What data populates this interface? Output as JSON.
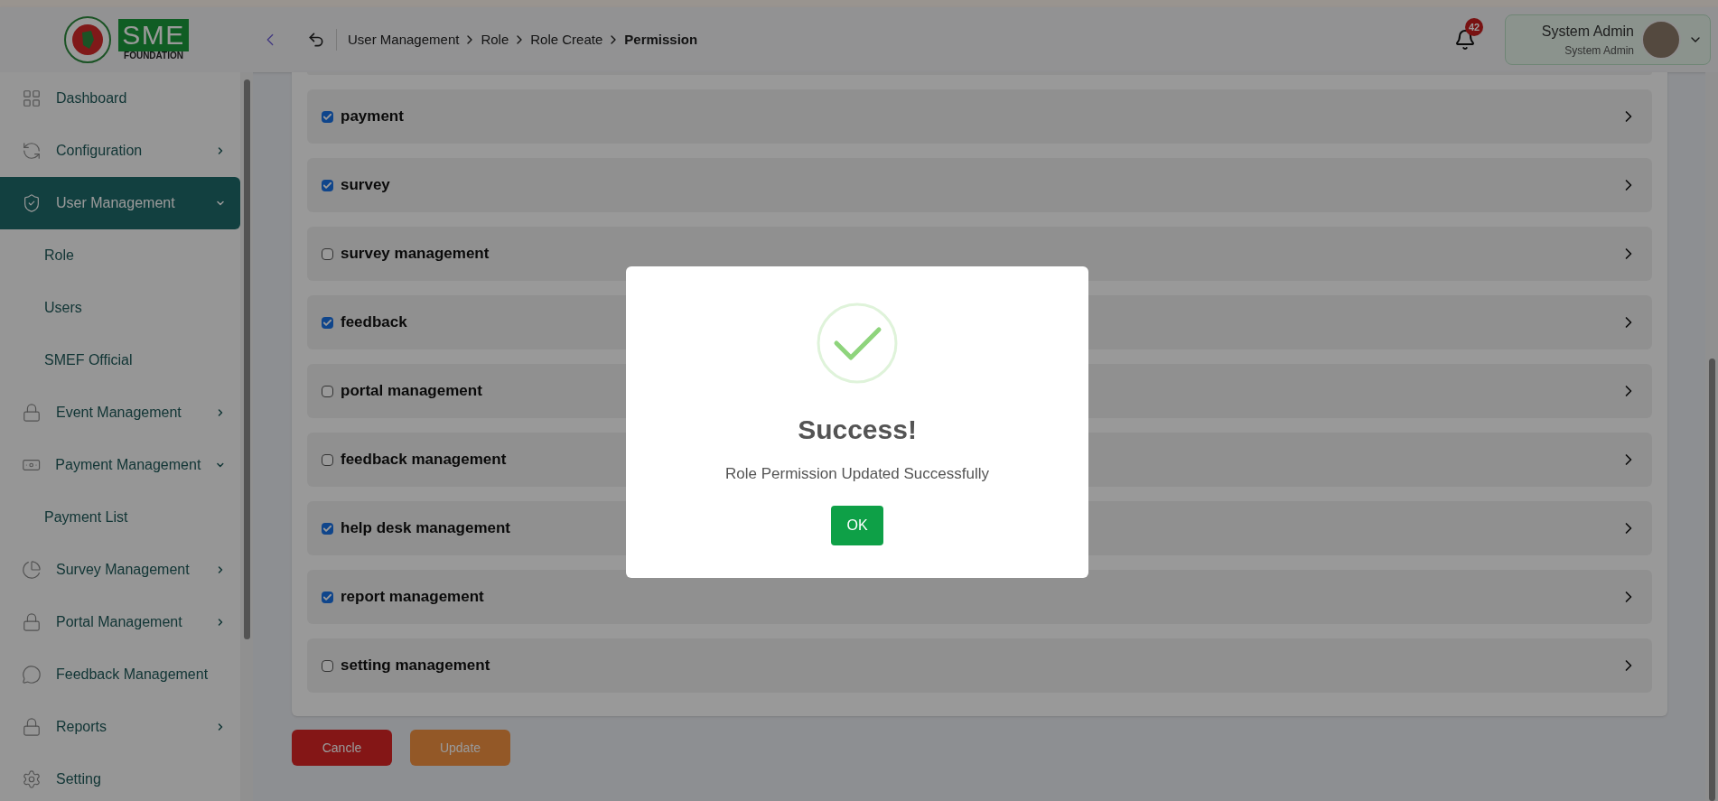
{
  "logo": {
    "title": "SME",
    "subtitle": "FOUNDATION"
  },
  "header": {
    "breadcrumb": [
      {
        "label": "User Management",
        "current": false
      },
      {
        "label": "Role",
        "current": false
      },
      {
        "label": "Role Create",
        "current": false
      },
      {
        "label": "Permission",
        "current": true
      }
    ],
    "notifications": {
      "count": "42"
    },
    "user": {
      "name": "System Admin",
      "role": "System Admin"
    }
  },
  "sidebar": {
    "items": [
      {
        "label": "Dashboard",
        "kind": "link",
        "selected": false
      },
      {
        "label": "Configuration",
        "kind": "group",
        "expanded": false,
        "selected": false
      },
      {
        "label": "User Management",
        "kind": "group",
        "expanded": true,
        "selected": true,
        "children": [
          {
            "label": "Role"
          },
          {
            "label": "Users"
          },
          {
            "label": "SMEF Official"
          }
        ]
      },
      {
        "label": "Event Management",
        "kind": "group",
        "expanded": false,
        "selected": false
      },
      {
        "label": "Payment Management",
        "kind": "group",
        "expanded": true,
        "selected": false,
        "children": [
          {
            "label": "Payment List"
          }
        ]
      },
      {
        "label": "Survey Management",
        "kind": "group",
        "expanded": false,
        "selected": false
      },
      {
        "label": "Portal Management",
        "kind": "group",
        "expanded": false,
        "selected": false
      },
      {
        "label": "Feedback Management",
        "kind": "link",
        "selected": false
      },
      {
        "label": "Reports",
        "kind": "group",
        "expanded": false,
        "selected": false
      },
      {
        "label": "Setting",
        "kind": "link",
        "selected": false
      }
    ]
  },
  "permissions": [
    {
      "label": "payment",
      "checked": true
    },
    {
      "label": "survey",
      "checked": true
    },
    {
      "label": "survey management",
      "checked": false
    },
    {
      "label": "feedback",
      "checked": true
    },
    {
      "label": "portal management",
      "checked": false
    },
    {
      "label": "feedback management",
      "checked": false
    },
    {
      "label": "help desk management",
      "checked": true
    },
    {
      "label": "report management",
      "checked": true
    },
    {
      "label": "setting management",
      "checked": false
    }
  ],
  "buttons": [
    {
      "label": "Cancle",
      "kind": "danger"
    },
    {
      "label": "Update",
      "kind": "warning"
    }
  ],
  "dialog": {
    "title": "Success!",
    "message": "Role Permission Updated Successfully",
    "button": "OK"
  }
}
